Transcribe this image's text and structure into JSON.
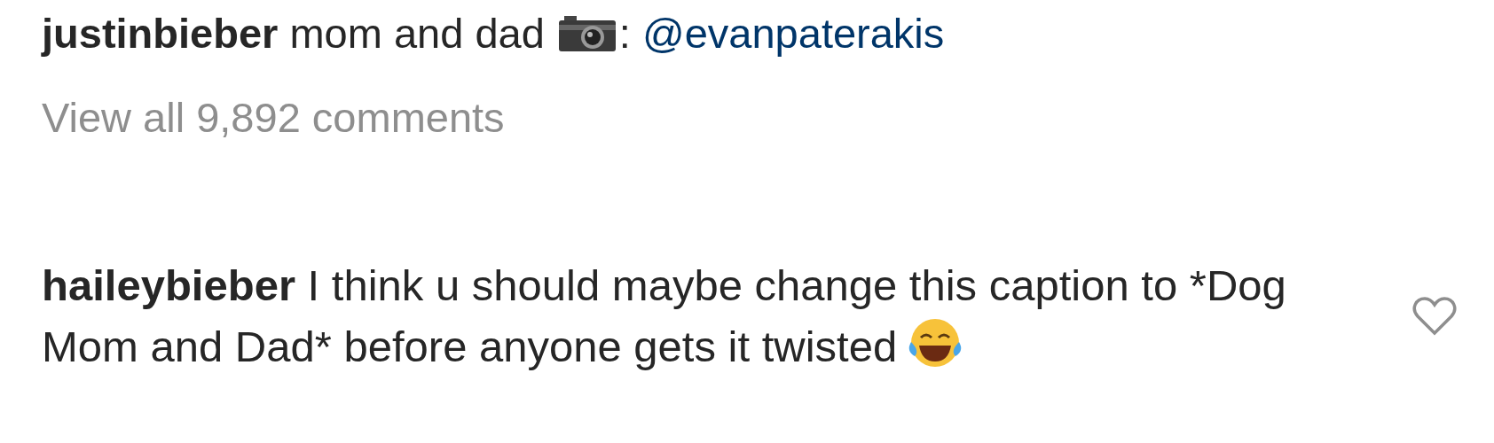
{
  "post_caption": {
    "username": "justinbieber",
    "text": "mom and dad",
    "separator": ":",
    "mention": "@evanpaterakis"
  },
  "view_comments": "View all 9,892 comments",
  "comments": [
    {
      "username": "haileybieber",
      "text": "I think u should maybe change this caption to *Dog Mom and Dad* before anyone gets it twisted",
      "liked": false
    }
  ]
}
